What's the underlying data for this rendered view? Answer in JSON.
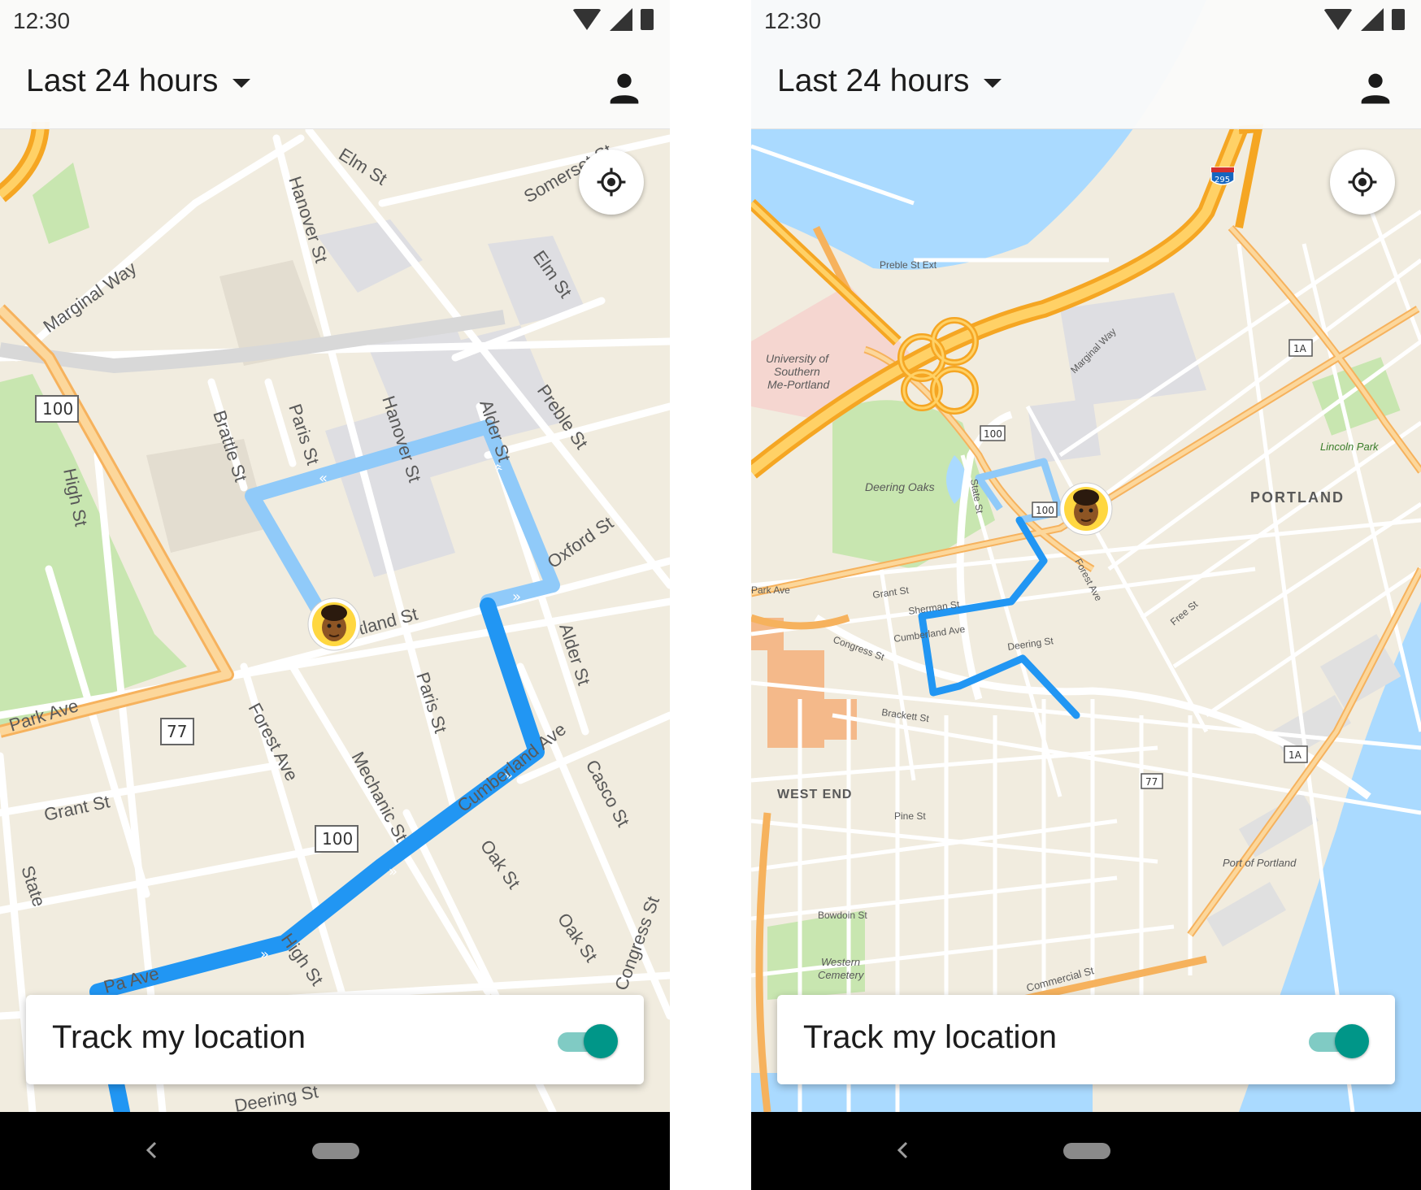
{
  "status_bar": {
    "time": "12:30",
    "icons": [
      "wifi-icon",
      "signal-icon",
      "battery-icon"
    ]
  },
  "app_bar": {
    "range_label": "Last 24 hours",
    "account_icon": "person-icon"
  },
  "locate_icon": "gps-fixed-icon",
  "track_card": {
    "label": "Track my location",
    "enabled": true
  },
  "colors": {
    "route_recent": "#2196f3",
    "route_older": "#90caf9",
    "toggle_on": "#009688",
    "map_bg": "#f1ecdf",
    "highway": "#ffc44d",
    "water": "#aadaff",
    "park": "#c8e6b0"
  },
  "left_map": {
    "streets": [
      "Elm St",
      "Somerset St",
      "Marginal Way",
      "Hanover St",
      "Elm St",
      "Paris St",
      "Hanover St",
      "Alder St",
      "Preble St",
      "Brattle St",
      "Oxford St",
      "High St",
      "Portland St",
      "Park Ave",
      "Forest Ave",
      "Paris St",
      "Alder St",
      "Cumberland Ave",
      "Mechanic St",
      "Casco St",
      "Grant St",
      "State",
      "Oak St",
      "Oak St",
      "High St",
      "Deering St",
      "Congress St",
      "Pa Ave"
    ],
    "shields": [
      "100",
      "77",
      "100"
    ]
  },
  "right_map": {
    "labels": [
      "University of",
      "Southern",
      "Me-Portland",
      "Deering Oaks",
      "PORTLAND",
      "Lincoln Park",
      "WEST END",
      "Western",
      "Cemetery",
      "Port of Portland",
      "Preble St Ext",
      "Marginal Way",
      "Grant St",
      "Sherman St",
      "Cumberland Ave",
      "Congress St",
      "Deering St",
      "Brackett St",
      "Pine St",
      "Bowdoin St",
      "Commercial St",
      "Forest Ave",
      "State St",
      "Free St",
      "Park Ave"
    ],
    "shields": [
      "295",
      "1A",
      "100",
      "100",
      "77",
      "1A"
    ]
  }
}
